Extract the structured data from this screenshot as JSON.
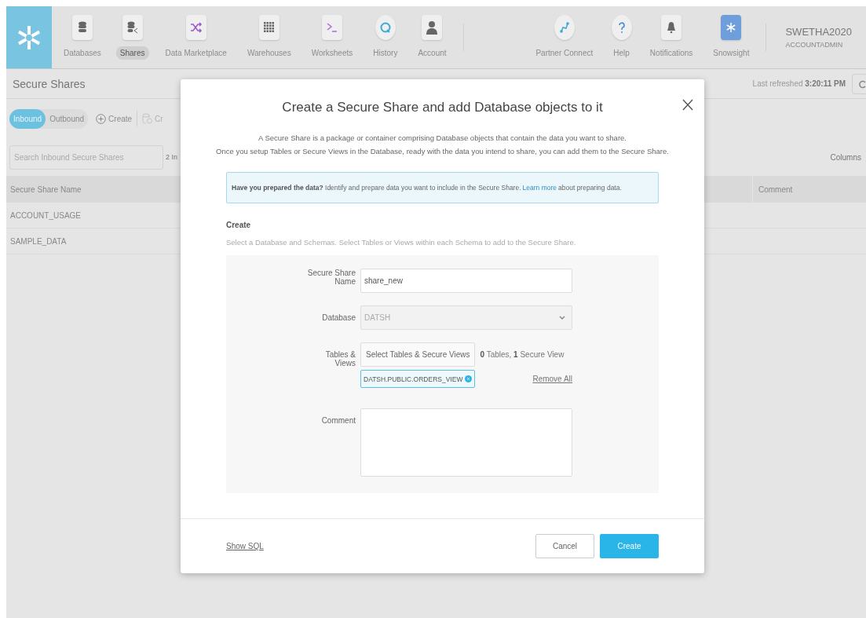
{
  "nav": {
    "items": [
      {
        "label": "Databases",
        "selected": false
      },
      {
        "label": "Shares",
        "selected": true
      },
      {
        "label": "Data Marketplace",
        "selected": false
      },
      {
        "label": "Warehouses",
        "selected": false
      },
      {
        "label": "Worksheets",
        "selected": false
      },
      {
        "label": "History",
        "selected": false
      },
      {
        "label": "Account",
        "selected": false
      }
    ],
    "right_items": [
      {
        "label": "Partner Connect"
      },
      {
        "label": "Help"
      },
      {
        "label": "Notifications"
      },
      {
        "label": "Snowsight"
      }
    ],
    "user": {
      "name": "SWETHA2020",
      "role": "ACCOUNTADMIN"
    }
  },
  "page": {
    "title": "Secure Shares",
    "last_refreshed": "Last refreshed **3:20:11 PM**"
  },
  "toolbar": {
    "toggle": [
      {
        "label": "Inbound",
        "selected": true
      },
      {
        "label": "Outbound",
        "selected": false
      }
    ],
    "create": "Create",
    "cut_button": "Cr"
  },
  "search": {
    "placeholder": "Search Inbound Secure Shares",
    "count": "2 In",
    "columns": "Columns"
  },
  "table": {
    "columns": [
      "Secure Share Name",
      "Comment"
    ],
    "rows": [
      [
        "ACCOUNT_USAGE"
      ],
      [
        "SAMPLE_DATA"
      ]
    ]
  },
  "dialog": {
    "title": "Create a Secure Share and add Database objects to it",
    "description": [
      "A Secure Share is a package or container comprising Database objects that contain the data you want to share.",
      "Once you setup Tables or Secure Views in the Database, ready with the data you intend to share, you can add them to the Secure Share."
    ],
    "info": {
      "text": "**Have you prepared the data?** Identify and prepare data you want to include in the Secure Share.",
      "link": "Learn more",
      "text_after": "about preparing data."
    },
    "section": {
      "title": "Create",
      "hint": "Select a Database and Schemas. Select Tables or Views within each Schema to add to the Secure Share."
    },
    "form": {
      "name_label": "Secure Share Name",
      "name_value": "share_new",
      "database_label": "Database",
      "database_value": "DATSH",
      "database_disabled": true,
      "tables_label": "Tables & Views",
      "tables_button": "Select Tables & Secure Views",
      "tables_summary": "**0** Tables, **1** Secure View",
      "chips": [
        "DATSH.PUBLIC.ORDERS_VIEW"
      ],
      "remove_all": "Remove All",
      "comment_label": "Comment"
    },
    "footer": {
      "show_sql": "Show SQL",
      "cancel": "Cancel",
      "create": "Create"
    }
  }
}
